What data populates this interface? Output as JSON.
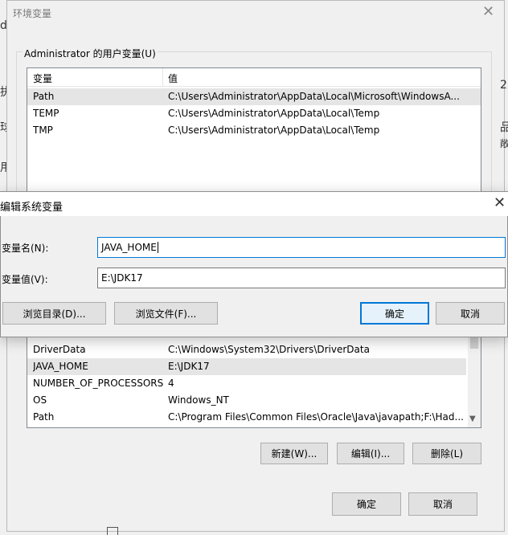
{
  "env_window": {
    "title": "环境变量",
    "user_vars": {
      "group_label": "Administrator 的用户变量(U)",
      "columns": [
        "变量",
        "值"
      ],
      "rows": [
        {
          "name": "Path",
          "value": "C:\\Users\\Administrator\\AppData\\Local\\Microsoft\\WindowsA..."
        },
        {
          "name": "TEMP",
          "value": "C:\\Users\\Administrator\\AppData\\Local\\Temp"
        },
        {
          "name": "TMP",
          "value": "C:\\Users\\Administrator\\AppData\\Local\\Temp"
        }
      ]
    },
    "system_vars": {
      "rows": [
        {
          "name": "DriverData",
          "value": "C:\\Windows\\System32\\Drivers\\DriverData"
        },
        {
          "name": "JAVA_HOME",
          "value": "E:\\JDK17"
        },
        {
          "name": "NUMBER_OF_PROCESSORS",
          "value": "4"
        },
        {
          "name": "OS",
          "value": "Windows_NT"
        },
        {
          "name": "Path",
          "value": "C:\\Program Files\\Common Files\\Oracle\\Java\\javapath;F:\\Had..."
        }
      ],
      "new_label": "新建(W)...",
      "edit_label": "编辑(I)...",
      "delete_label": "删除(L)"
    },
    "ok_label": "确定",
    "cancel_label": "取消"
  },
  "edit_dialog": {
    "title": "编辑系统变量",
    "name_label": "变量名(N):",
    "name_value": "JAVA_HOME",
    "value_label": "变量值(V):",
    "value_value": "E:\\JDK17",
    "browse_dir_label": "浏览目录(D)...",
    "browse_file_label": "浏览文件(F)...",
    "ok_label": "确定",
    "cancel_label": "取消"
  },
  "edge_fragments": [
    "d",
    "执",
    "球",
    "用",
    "2.",
    "品",
    "敞"
  ]
}
